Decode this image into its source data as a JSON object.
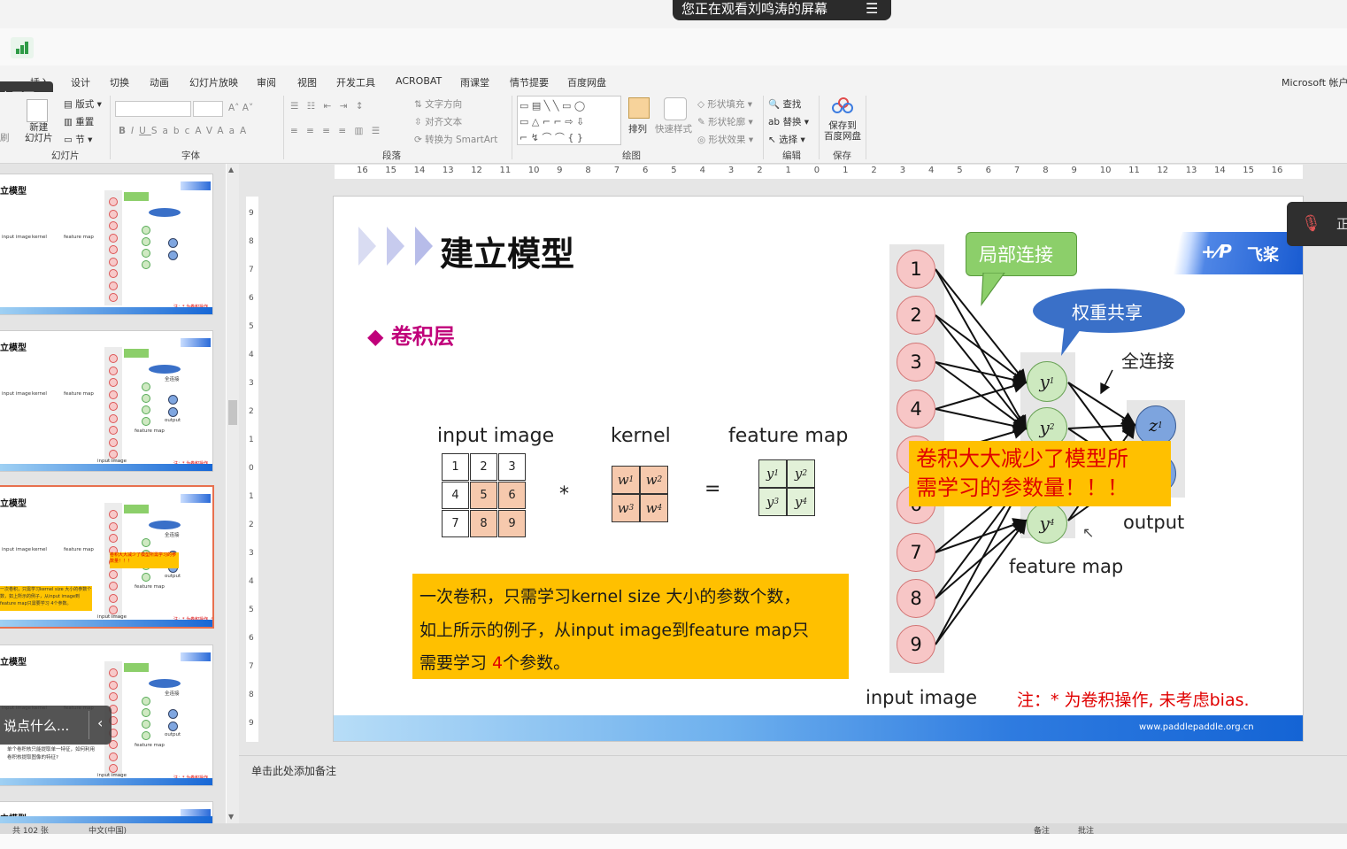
{
  "share_banner": {
    "text": "您正在观看刘鸣涛的屏幕",
    "menu_icon": "menu-icon"
  },
  "ribbon": {
    "tabs": [
      "插入",
      "设计",
      "切换",
      "动画",
      "幻灯片放映",
      "审阅",
      "视图",
      "开发工具",
      "ACROBAT",
      "雨课堂",
      "情节提要",
      "百度网盘"
    ],
    "account": "Microsoft 帐户",
    "fixed_screen": "定画面",
    "slides_group": {
      "layout": "版式",
      "reset": "重置",
      "section": "节",
      "new_slide": "新建\n幻灯片",
      "label": "幻灯片",
      "partial": "刷"
    },
    "font_group": {
      "label": "字体",
      "buttons": [
        "B",
        "I",
        "U",
        "S",
        "abc",
        "AV",
        "Aa",
        "A"
      ]
    },
    "paragraph_group": {
      "label": "段落",
      "text_direction": "文字方向",
      "align_text": "对齐文本",
      "convert_smartart": "转换为 SmartArt"
    },
    "drawing_group": {
      "label": "绘图",
      "arrange": "排列",
      "quick_styles": "快速样式",
      "shape_fill": "形状填充",
      "shape_outline": "形状轮廓",
      "shape_effects": "形状效果"
    },
    "edit_group": {
      "label": "编辑",
      "find": "查找",
      "replace": "替换",
      "select": "选择"
    },
    "save_group": {
      "label": "保存",
      "save_baidu": "保存到\n百度网盘"
    }
  },
  "ruler": {
    "h": [
      "16",
      "15",
      "14",
      "13",
      "12",
      "11",
      "10",
      "9",
      "8",
      "7",
      "6",
      "5",
      "4",
      "3",
      "2",
      "1",
      "0",
      "1",
      "2",
      "3",
      "4",
      "5",
      "6",
      "7",
      "8",
      "9",
      "10",
      "11",
      "12",
      "13",
      "14",
      "15",
      "16"
    ],
    "v": [
      "9",
      "8",
      "7",
      "6",
      "5",
      "4",
      "3",
      "2",
      "1",
      "0",
      "1",
      "2",
      "3",
      "4",
      "5",
      "6",
      "7",
      "8",
      "9"
    ]
  },
  "thumbnails": [
    {
      "title": "立模型"
    },
    {
      "title": "立模型"
    },
    {
      "title": "立模型",
      "selected": true
    },
    {
      "title": "立模型"
    },
    {
      "title": "立模型"
    }
  ],
  "thumb_texts": {
    "local": "局部连接",
    "share": "权重共享",
    "full": "全连接",
    "input_image": "input image",
    "kernel": "kernel",
    "feature_map": "feature map",
    "output": "output",
    "note": "注：* 为卷积操作",
    "note_bias": "注：* 为卷积操作, 未考虑bias.",
    "bubble": "卷积大大减少了模型所需学习的参数量！！！",
    "sel_yellow": "一次卷积，只需学习kernel size 大小的参数个数，如上所示的例子，从input image到feature map只需要学习 4个参数。",
    "t4_text": "单个卷积核只能提取单一特征，如何利用卷积核提取图像的特征?"
  },
  "chat_bubble": "说点什么...",
  "slide": {
    "title": "建立模型",
    "subtitle": "卷积层",
    "logo_text": "飞桨",
    "input_label": "input image",
    "kernel_label": "kernel",
    "feature_label": "feature map",
    "matrix": [
      "1",
      "2",
      "3",
      "4",
      "5",
      "6",
      "7",
      "8",
      "9"
    ],
    "op_star": "*",
    "op_eq": "=",
    "kernel_cells": [
      "w",
      "w",
      "w",
      "w"
    ],
    "kernel_subs": [
      "1",
      "2",
      "3",
      "4"
    ],
    "feature_cells": [
      "y",
      "y",
      "y",
      "y"
    ],
    "feature_subs": [
      "1",
      "2",
      "3",
      "4"
    ],
    "yellow_line1": "一次卷积，只需学习kernel size 大小的参数个数，",
    "yellow_line2": "如上所示的例子，从input image到feature map只",
    "yellow_line3a": "需要学习 ",
    "yellow_line3b": "4",
    "yellow_line3c": "个参数。",
    "local_conn": "局部连接",
    "weight_share": "权重共享",
    "full_conn": "全连接",
    "nodes": [
      "1",
      "2",
      "3",
      "4",
      "5",
      "6",
      "7",
      "8",
      "9"
    ],
    "hidden": [
      "y",
      "y",
      "y",
      "y"
    ],
    "hidden_subs": [
      "1",
      "2",
      "3",
      "4"
    ],
    "outputs": [
      "z"
    ],
    "output_subs": [
      "1"
    ],
    "callout": "卷积大大减少了模型所\n需学习的参数量！！！",
    "output_label": "output",
    "feature_map_label": "feature map",
    "input_image_bottom": "input image",
    "note": "注：* 为卷积操作, 未考虑bias.",
    "url": "www.paddlepaddle.org.cn"
  },
  "notes_placeholder": "单击此处添加备注",
  "status": {
    "slide_count": "共 102 张",
    "lang": "中文(中国)",
    "notes": "备注",
    "comments": "批注"
  },
  "colors": {
    "accent_red": "#e8704e",
    "title_magenta": "#c0007a",
    "yellow_box": "#ffc000",
    "blue_band": "#1767d6"
  },
  "icons": [
    "chart-icon",
    "mic-muted-icon",
    "menu-icon",
    "find-icon",
    "replace-icon",
    "select-icon",
    "baidu-cloud-icon"
  ]
}
